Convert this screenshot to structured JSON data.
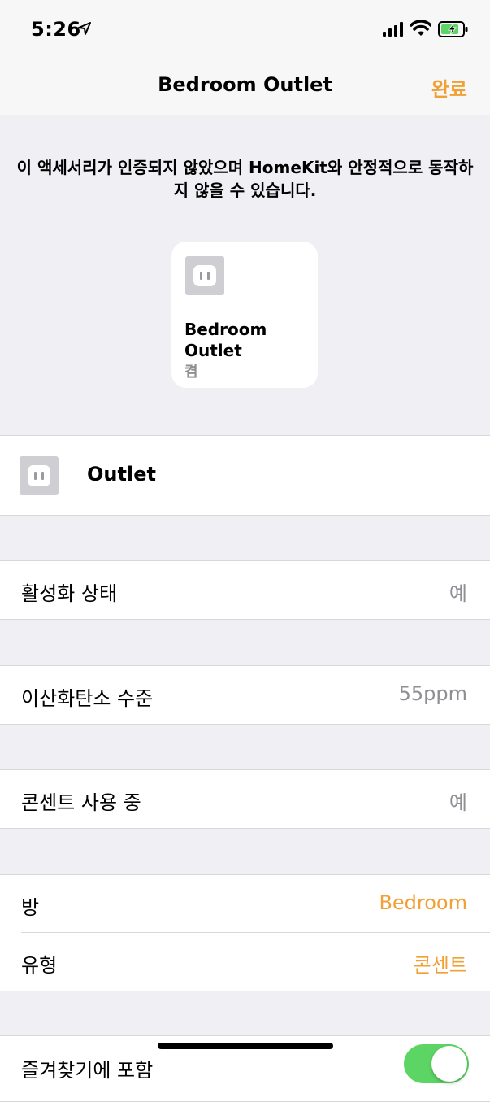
{
  "status_bar": {
    "time": "5:26"
  },
  "nav": {
    "title": "Bedroom Outlet",
    "done_label": "완료"
  },
  "warning": "이 액세서리가 인증되지 않았으며 HomeKit와 안정적으로 동작하지 않을 수 있습니다.",
  "tile": {
    "name_line1": "Bedroom",
    "name_line2": "Outlet",
    "status": "켬"
  },
  "service": {
    "label": "Outlet"
  },
  "rows": {
    "active": {
      "label": "활성화 상태",
      "value": "예"
    },
    "co2": {
      "label": "이산화탄소 수준",
      "value": "55ppm"
    },
    "in_use": {
      "label": "콘센트 사용 중",
      "value": "예"
    },
    "room": {
      "label": "방",
      "value": "Bedroom"
    },
    "type": {
      "label": "유형",
      "value": "콘센트"
    },
    "favorites": {
      "label": "즐겨찾기에 포함",
      "toggle_on": true
    }
  },
  "colors": {
    "accent": "#f0a035",
    "toggle_on": "#5cd564",
    "value_gray": "#8e8e93"
  },
  "icons": [
    "location-arrow-icon",
    "signal-icon",
    "wifi-icon",
    "battery-icon",
    "outlet-icon"
  ]
}
